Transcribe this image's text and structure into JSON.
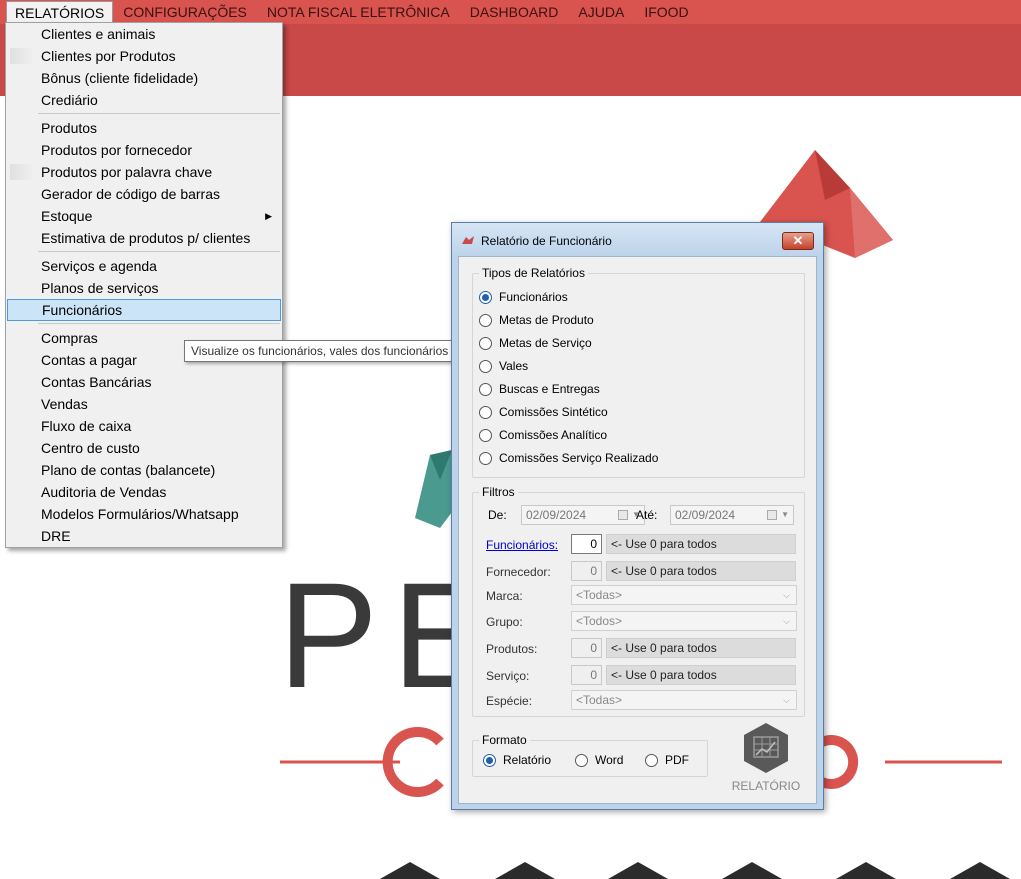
{
  "menubar": {
    "items": [
      {
        "label": "RELATÓRIOS"
      },
      {
        "label": "CONFIGURAÇÕES"
      },
      {
        "label": "NOTA FISCAL ELETRÔNICA"
      },
      {
        "label": "DASHBOARD"
      },
      {
        "label": "AJUDA"
      },
      {
        "label": "IFOOD"
      }
    ]
  },
  "background": {
    "logo_text": "PE    OP",
    "accent": "#d9534f"
  },
  "dropdown": {
    "items": [
      "Clientes e animais",
      "Clientes por Produtos",
      "Bônus (cliente fidelidade)",
      "Crediário",
      "Produtos",
      "Produtos por fornecedor",
      "Produtos por palavra chave",
      "Gerador de código de barras",
      "Estoque",
      "Estimativa de produtos p/ clientes",
      "Serviços e agenda",
      "Planos de serviços",
      "Funcionários",
      "Compras",
      "Contas a pagar",
      "Contas Bancárias",
      "Vendas",
      "Fluxo de caixa",
      "Centro de custo",
      "Plano de contas (balancete)",
      "Auditoria de Vendas",
      "Modelos Formulários/Whatsapp",
      "DRE"
    ],
    "submenu_arrow": "▶"
  },
  "tooltip": {
    "text": "Visualize os funcionários, vales dos funcionários e comissões."
  },
  "dialog": {
    "title": "Relatório de Funcionário",
    "close": "✕",
    "tipos": {
      "legend": "Tipos de Relatórios",
      "options": [
        "Funcionários",
        "Metas de Produto",
        "Metas de Serviço",
        "Vales",
        "Buscas e Entregas",
        "Comissões Sintético",
        "Comissões Analítico",
        "Comissões Serviço Realizado"
      ],
      "selected": 0
    },
    "filtros": {
      "legend": "Filtros",
      "de_label": "De:",
      "de_value": "02/09/2024",
      "ate_label": "Até:",
      "ate_value": "02/09/2024",
      "funcionarios_label": "Funcionários:",
      "funcionarios_value": "0",
      "funcionarios_hint": "<- Use 0 para todos",
      "fornecedor_label": "Fornecedor:",
      "fornecedor_value": "0",
      "fornecedor_hint": "<- Use 0 para todos",
      "marca_label": "Marca:",
      "marca_value": "<Todas>",
      "grupo_label": "Grupo:",
      "grupo_value": "<Todos>",
      "produtos_label": "Produtos:",
      "produtos_value": "0",
      "produtos_hint": "<- Use 0 para todos",
      "servico_label": "Serviço:",
      "servico_value": "0",
      "servico_hint": "<- Use 0 para todos",
      "especie_label": "Espécie:",
      "especie_value": "<Todas>"
    },
    "formato": {
      "legend": "Formato",
      "options": [
        "Relatório",
        "Word",
        "PDF"
      ],
      "selected": 0
    },
    "report_button": {
      "label": "RELATÓRIO"
    }
  }
}
